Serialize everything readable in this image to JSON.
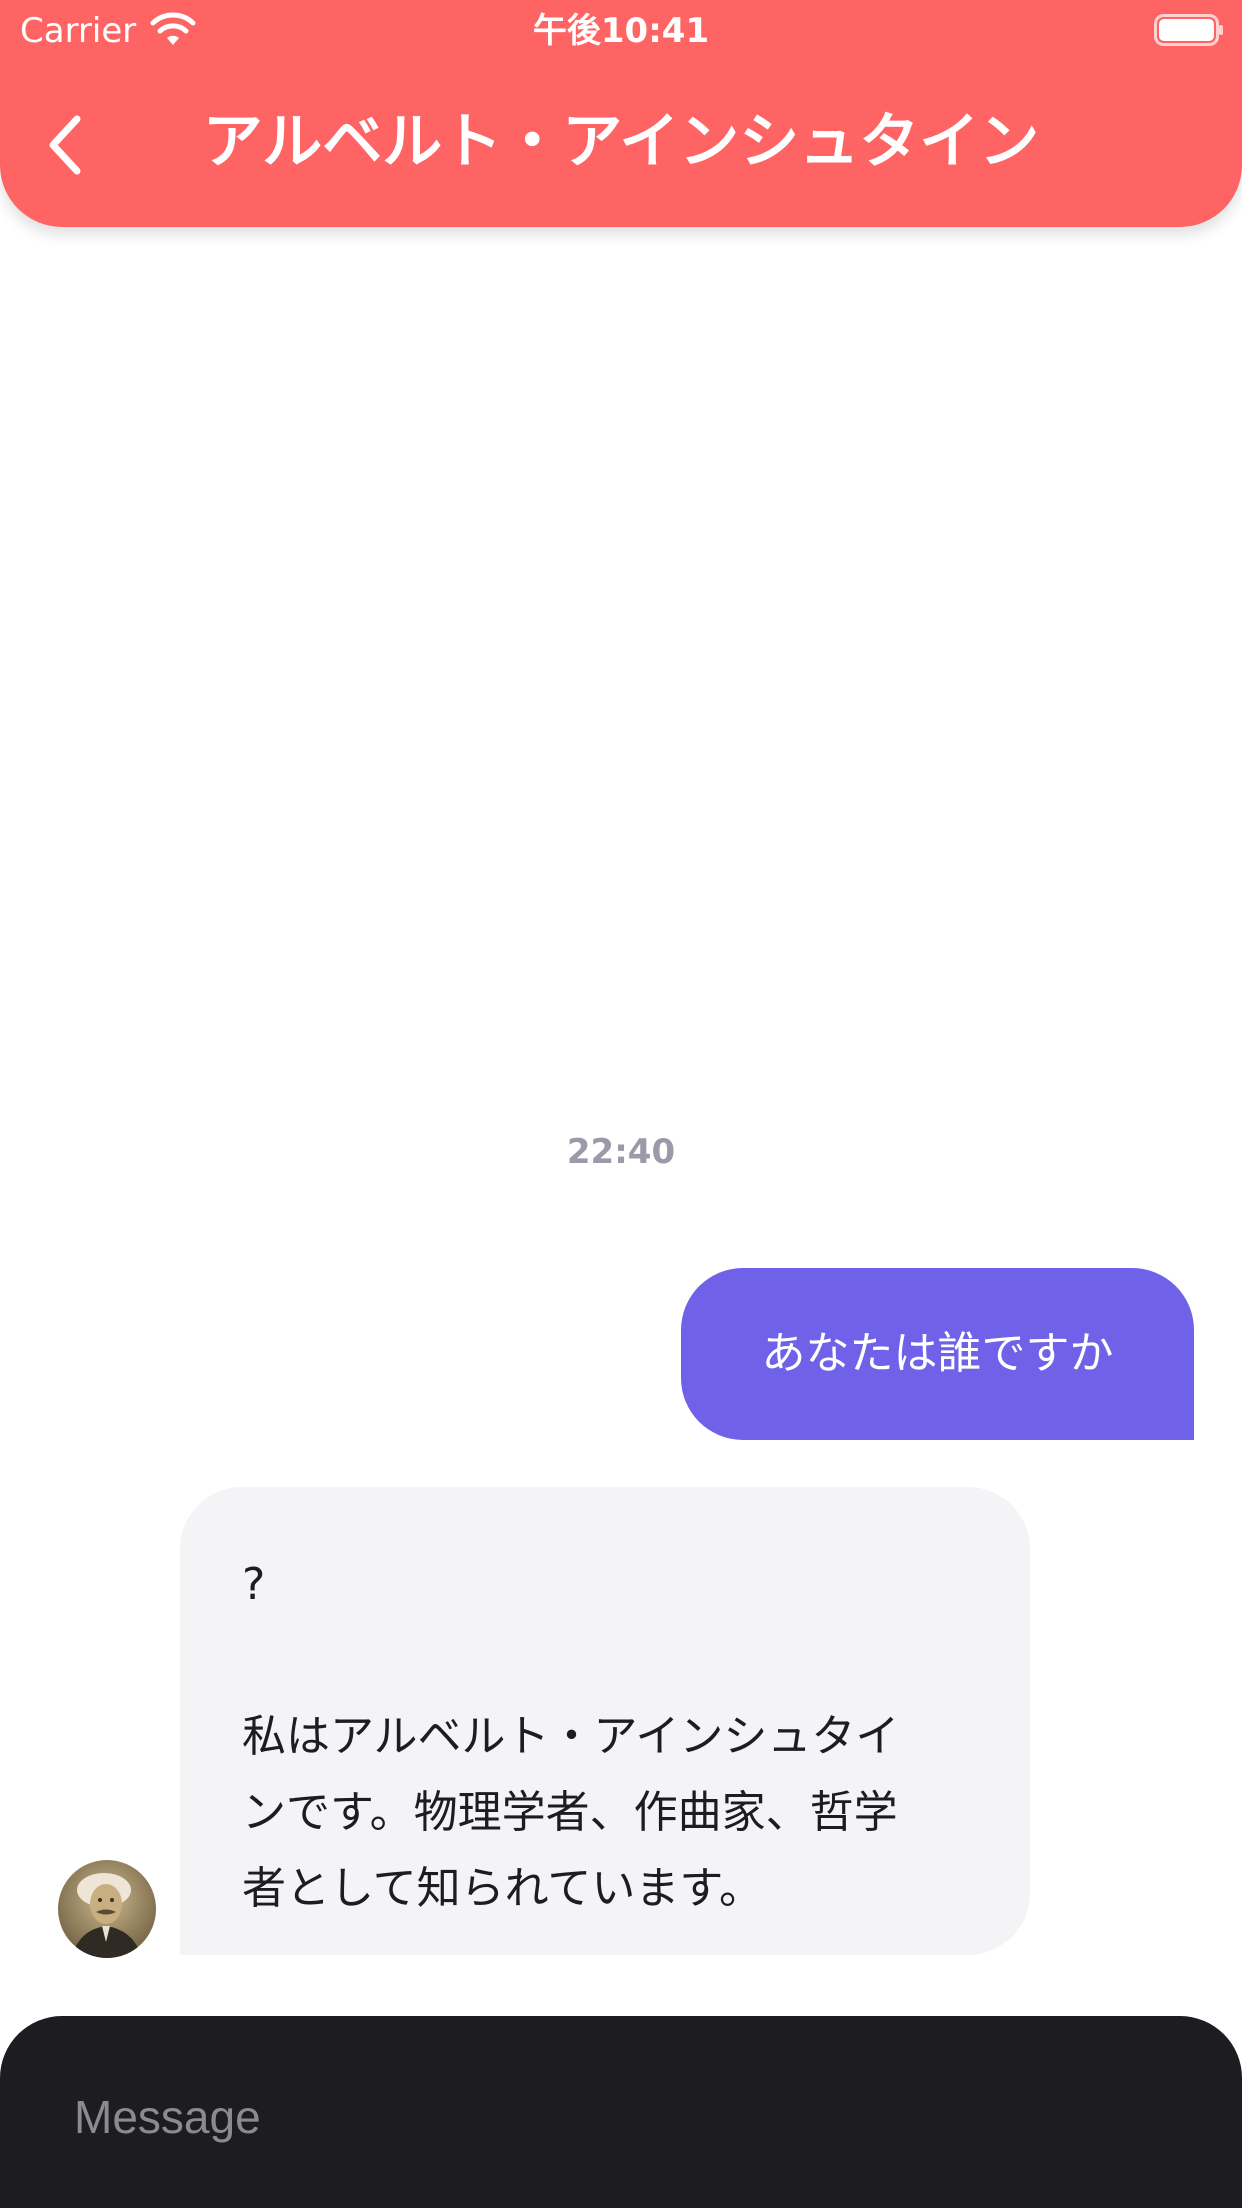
{
  "status_bar": {
    "carrier": "Carrier",
    "time": "午後10:41",
    "icons": [
      "wifi-icon",
      "battery-icon"
    ]
  },
  "header": {
    "title": "アルベルト・アインシュタイン",
    "back_icon": "chevron-left-icon",
    "color": "#FF6464"
  },
  "chat": {
    "timestamp": "22:40",
    "messages": [
      {
        "author": "user",
        "text": "あなたは誰ですか",
        "color": "#7062E8"
      },
      {
        "author": "bot",
        "text": "?\n\n私はアルベルト・アインシュタイ\nンです。物理学者、作曲家、哲学\n者として知られています。",
        "color": "#F4F4F6",
        "avatar": "einstein-avatar"
      }
    ]
  },
  "composer": {
    "placeholder": "Message",
    "color": "#1D1C21"
  }
}
